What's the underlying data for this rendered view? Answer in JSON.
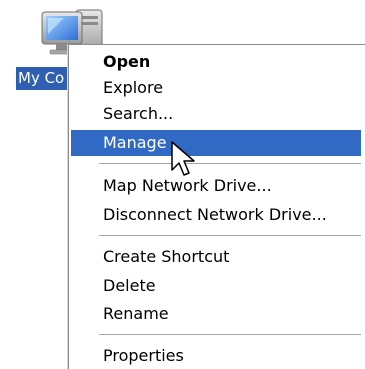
{
  "desktop_icon": {
    "label": "My Co",
    "icon": "my-computer-icon"
  },
  "context_menu": {
    "items": [
      {
        "label": "Open",
        "bold": true
      },
      {
        "label": "Explore"
      },
      {
        "label": "Search..."
      },
      {
        "label": "Manage",
        "highlighted": true
      },
      {
        "label": "Map Network Drive..."
      },
      {
        "label": "Disconnect Network Drive..."
      },
      {
        "label": "Create Shortcut"
      },
      {
        "label": "Delete"
      },
      {
        "label": "Rename"
      },
      {
        "label": "Properties"
      }
    ]
  },
  "cursor": {
    "icon": "arrow-pointer-icon"
  },
  "colors": {
    "selection": "#316ac5",
    "label_selection": "#2f5fb3",
    "separator": "#a7a6aa"
  }
}
